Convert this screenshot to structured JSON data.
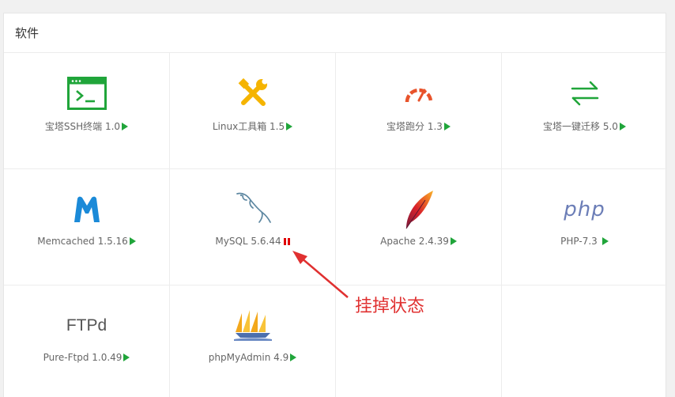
{
  "panel": {
    "title": "软件"
  },
  "software": [
    {
      "label": "宝塔SSH终端 1.0",
      "status": "play",
      "icon": "terminal-icon"
    },
    {
      "label": "Linux工具箱 1.5",
      "status": "play",
      "icon": "tools-icon"
    },
    {
      "label": "宝塔跑分 1.3",
      "status": "play",
      "icon": "gauge-icon"
    },
    {
      "label": "宝塔一键迁移 5.0",
      "status": "play",
      "icon": "transfer-arrows-icon"
    },
    {
      "label": "Memcached 1.5.16",
      "status": "play",
      "icon": "memcached-logo-icon"
    },
    {
      "label": "MySQL 5.6.44",
      "status": "pause",
      "icon": "mysql-dolphin-icon"
    },
    {
      "label": "Apache 2.4.39",
      "status": "play",
      "icon": "apache-feather-icon"
    },
    {
      "label": "PHP-7.3",
      "status": "play",
      "icon": "php-logo-icon",
      "logo_text": "php"
    },
    {
      "label": "Pure-Ftpd 1.0.49",
      "status": "play",
      "icon": "ftp-logo-icon",
      "logo_text": "FTPd"
    },
    {
      "label": "phpMyAdmin 4.9",
      "status": "play",
      "icon": "phpmyadmin-sailboat-icon"
    }
  ],
  "annotation": {
    "text": "挂掉状态"
  },
  "colors": {
    "running": "#20a53a",
    "stopped": "#e00000",
    "annotation": "#e03030"
  }
}
